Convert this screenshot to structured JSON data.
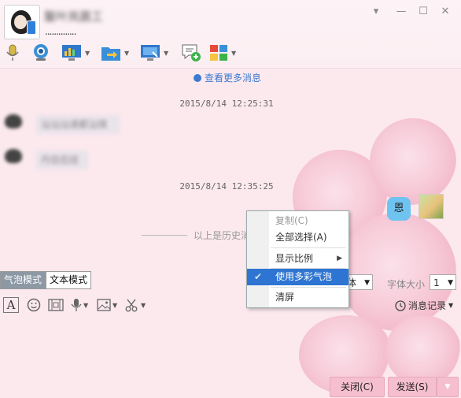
{
  "header": {
    "contact_name": "鳌叶岚晨工",
    "signature": "..............",
    "window_controls": [
      "▾",
      "—",
      "☐",
      "✕"
    ]
  },
  "toolbar": {
    "items": [
      "voice-call",
      "video-call",
      "remote-desktop",
      "send-file",
      "screen-share",
      "create-discussion",
      "apps"
    ]
  },
  "chat": {
    "more_messages": "查看更多消息",
    "messages": [
      {
        "type": "timestamp",
        "text": "2015/8/14 12:25:31"
      },
      {
        "type": "incoming",
        "text": "汕汕汕请都汕琪"
      },
      {
        "type": "incoming",
        "text": "丹目后班"
      },
      {
        "type": "timestamp",
        "text": "2015/8/14 12:35:25"
      },
      {
        "type": "outgoing",
        "text": "恩"
      }
    ],
    "history_divider": "以上是历史消"
  },
  "mode_bar": {
    "bubble_mode": "气泡模式",
    "text_mode": "文本模式",
    "font_value": "体",
    "font_size_label": "字体大小",
    "font_size_value": "1"
  },
  "input_toolbar": {
    "font_icon_label": "A",
    "history_label": "消息记录"
  },
  "context_menu": {
    "items": [
      {
        "label": "复制(C)",
        "disabled": true
      },
      {
        "label": "全部选择(A)",
        "disabled": false
      },
      {
        "label": "显示比例",
        "submenu": true
      },
      {
        "label": "使用多彩气泡",
        "checked": true,
        "highlighted": true
      },
      {
        "label": "清屏"
      }
    ]
  },
  "bottom": {
    "close_label": "关闭(C)",
    "send_label": "发送(S)"
  },
  "colors": {
    "accent": "#2e74d2",
    "link": "#3d7ad0",
    "button_pink": "#f6bfd0",
    "bubble_blue": "#6fc3f1"
  }
}
